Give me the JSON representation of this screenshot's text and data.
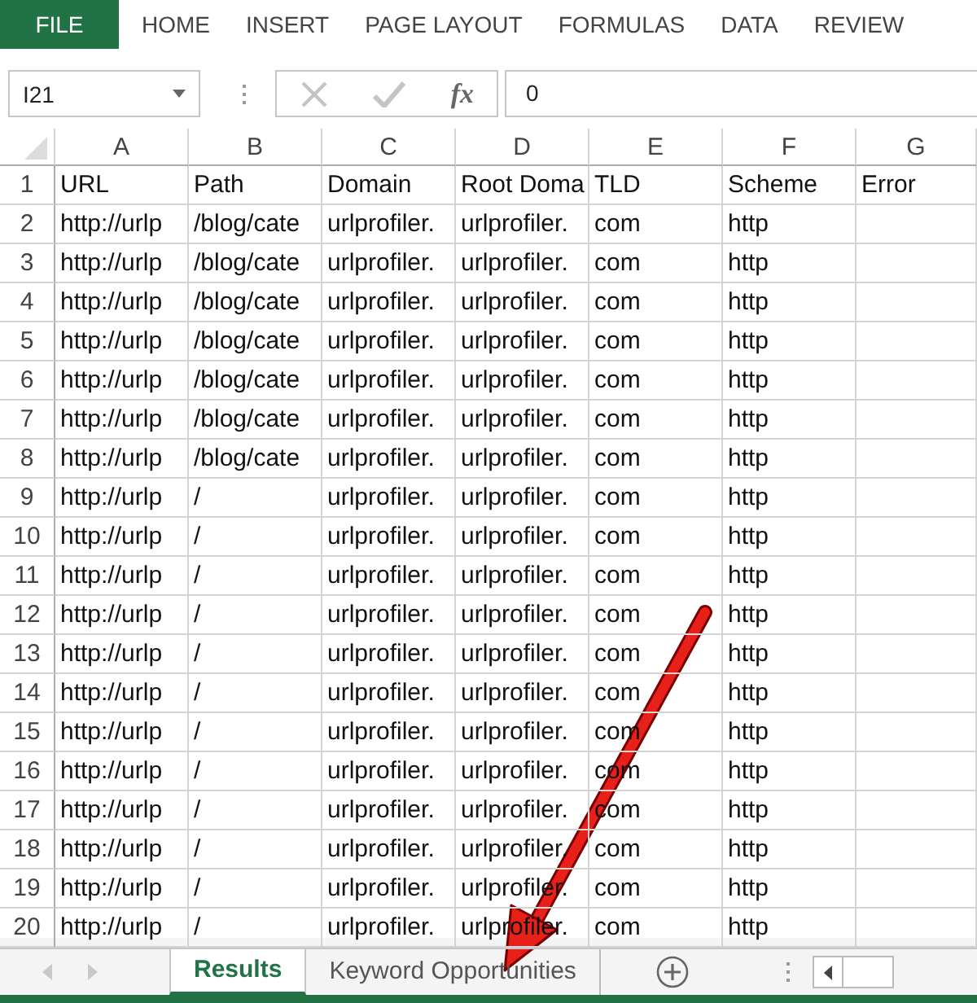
{
  "ribbon": {
    "file_button": "FILE",
    "tabs": [
      "HOME",
      "INSERT",
      "PAGE LAYOUT",
      "FORMULAS",
      "DATA",
      "REVIEW"
    ]
  },
  "formula_bar": {
    "name_box": "I21",
    "function_symbol": "fx",
    "value": "0"
  },
  "sheet": {
    "columns": [
      "A",
      "B",
      "C",
      "D",
      "E",
      "F",
      "G"
    ],
    "rows": [
      {
        "number": "1",
        "cells": [
          "URL",
          "Path",
          "Domain",
          "Root Doma",
          "TLD",
          "Scheme",
          "Error"
        ]
      },
      {
        "number": "2",
        "cells": [
          "http://urlp",
          "/blog/cate",
          "urlprofiler.",
          "urlprofiler.",
          "com",
          "http"
        ]
      },
      {
        "number": "3",
        "cells": [
          "http://urlp",
          "/blog/cate",
          "urlprofiler.",
          "urlprofiler.",
          "com",
          "http"
        ]
      },
      {
        "number": "4",
        "cells": [
          "http://urlp",
          "/blog/cate",
          "urlprofiler.",
          "urlprofiler.",
          "com",
          "http"
        ]
      },
      {
        "number": "5",
        "cells": [
          "http://urlp",
          "/blog/cate",
          "urlprofiler.",
          "urlprofiler.",
          "com",
          "http"
        ]
      },
      {
        "number": "6",
        "cells": [
          "http://urlp",
          "/blog/cate",
          "urlprofiler.",
          "urlprofiler.",
          "com",
          "http"
        ]
      },
      {
        "number": "7",
        "cells": [
          "http://urlp",
          "/blog/cate",
          "urlprofiler.",
          "urlprofiler.",
          "com",
          "http"
        ]
      },
      {
        "number": "8",
        "cells": [
          "http://urlp",
          "/blog/cate",
          "urlprofiler.",
          "urlprofiler.",
          "com",
          "http"
        ]
      },
      {
        "number": "9",
        "cells": [
          "http://urlp",
          "/",
          "urlprofiler.",
          "urlprofiler.",
          "com",
          "http"
        ]
      },
      {
        "number": "10",
        "cells": [
          "http://urlp",
          "/",
          "urlprofiler.",
          "urlprofiler.",
          "com",
          "http"
        ]
      },
      {
        "number": "11",
        "cells": [
          "http://urlp",
          "/",
          "urlprofiler.",
          "urlprofiler.",
          "com",
          "http"
        ]
      },
      {
        "number": "12",
        "cells": [
          "http://urlp",
          "/",
          "urlprofiler.",
          "urlprofiler.",
          "com",
          "http"
        ]
      },
      {
        "number": "13",
        "cells": [
          "http://urlp",
          "/",
          "urlprofiler.",
          "urlprofiler.",
          "com",
          "http"
        ]
      },
      {
        "number": "14",
        "cells": [
          "http://urlp",
          "/",
          "urlprofiler.",
          "urlprofiler.",
          "com",
          "http"
        ]
      },
      {
        "number": "15",
        "cells": [
          "http://urlp",
          "/",
          "urlprofiler.",
          "urlprofiler.",
          "com",
          "http"
        ]
      },
      {
        "number": "16",
        "cells": [
          "http://urlp",
          "/",
          "urlprofiler.",
          "urlprofiler.",
          "com",
          "http"
        ]
      },
      {
        "number": "17",
        "cells": [
          "http://urlp",
          "/",
          "urlprofiler.",
          "urlprofiler.",
          "com",
          "http"
        ]
      },
      {
        "number": "18",
        "cells": [
          "http://urlp",
          "/",
          "urlprofiler.",
          "urlprofiler.",
          "com",
          "http"
        ]
      },
      {
        "number": "19",
        "cells": [
          "http://urlp",
          "/",
          "urlprofiler.",
          "urlprofiler.",
          "com",
          "http"
        ]
      },
      {
        "number": "20",
        "cells": [
          "http://urlp",
          "/",
          "urlprofiler.",
          "urlprofiler.",
          "com",
          "http"
        ]
      }
    ]
  },
  "sheet_tabs": [
    {
      "label": "Results",
      "selected": true
    },
    {
      "label": "Keyword Opportunities",
      "selected": false
    }
  ]
}
